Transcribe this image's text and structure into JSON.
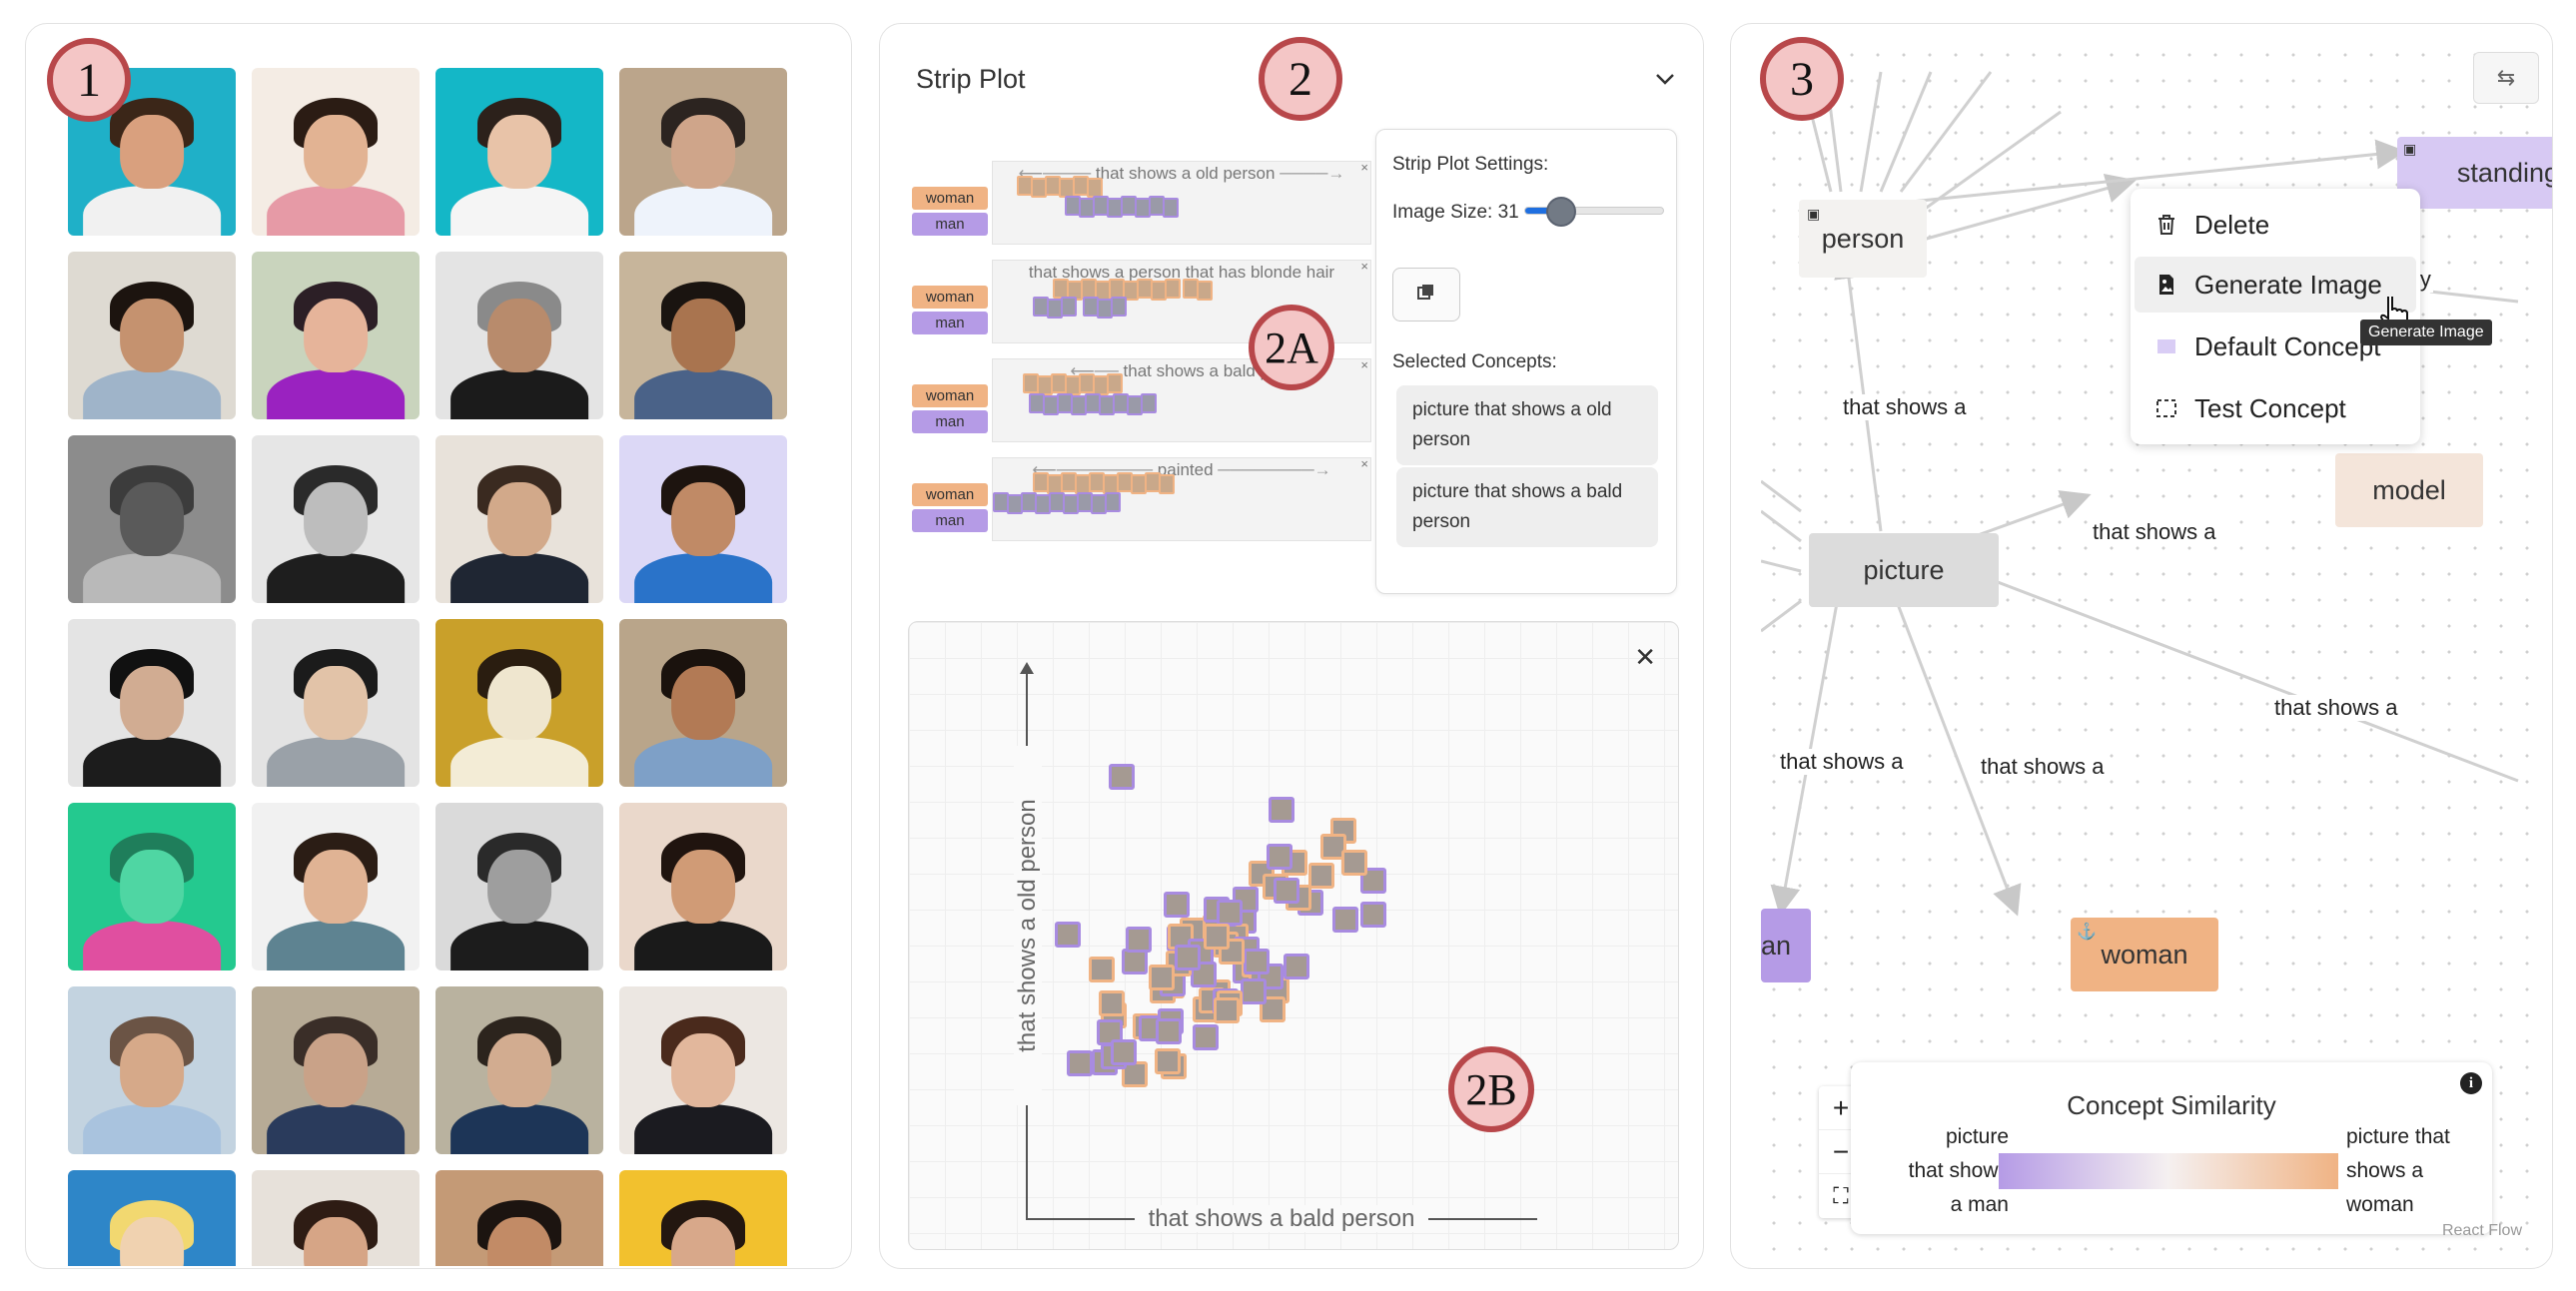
{
  "badges": {
    "b1": "1",
    "b2": "2",
    "b3": "3",
    "b2a": "2A",
    "b2b": "2B"
  },
  "gallery": {
    "thumbs": [
      {
        "bg": "#1fb0c8",
        "skin": "#d9a07e",
        "hair": "#3b2618",
        "body": "#f1f1f1"
      },
      {
        "bg": "#f4ece4",
        "skin": "#e2b393",
        "hair": "#2b1c14",
        "body": "#e69aa6"
      },
      {
        "bg": "#14b7c7",
        "skin": "#e8c3a8",
        "hair": "#2c211b",
        "body": "#f5f5f5"
      },
      {
        "bg": "#bba58b",
        "skin": "#cfa58a",
        "hair": "#2c2420",
        "body": "#eef3fb"
      },
      {
        "bg": "#dedad2",
        "skin": "#c5926f",
        "hair": "#1c140f",
        "body": "#9fb4c9"
      },
      {
        "bg": "#c9d4bd",
        "skin": "#e6b49a",
        "hair": "#2c1f26",
        "body": "#9a22c0"
      },
      {
        "bg": "#e4e4e4",
        "skin": "#b88b6c",
        "hair": "#8a8a8a",
        "body": "#1b1b1b"
      },
      {
        "bg": "#c7b59b",
        "skin": "#a9744f",
        "hair": "#1a1410",
        "body": "#4a6288"
      },
      {
        "bg": "#8c8c8c",
        "skin": "#5a5a5a",
        "hair": "#3c3c3c",
        "body": "#b9b9b9"
      },
      {
        "bg": "#e6e6e6",
        "skin": "#bdbdbd",
        "hair": "#2a2a2a",
        "body": "#1e1e1e"
      },
      {
        "bg": "#e8e2da",
        "skin": "#d2a98a",
        "hair": "#3a2a20",
        "body": "#1f2633"
      },
      {
        "bg": "#dcd8f6",
        "skin": "#c08a66",
        "hair": "#1d140f",
        "body": "#2a73c9"
      },
      {
        "bg": "#e4e4e4",
        "skin": "#d1ac92",
        "hair": "#111111",
        "body": "#1c1c1c"
      },
      {
        "bg": "#e3e3e3",
        "skin": "#e2c3a8",
        "hair": "#1b1b1b",
        "body": "#9aa1a8"
      },
      {
        "bg": "#c9a02a",
        "skin": "#efe6cf",
        "hair": "#2a1d10",
        "body": "#f3ecd6"
      },
      {
        "bg": "#b9a58a",
        "skin": "#b27a55",
        "hair": "#1a120d",
        "body": "#7ea0c7"
      },
      {
        "bg": "#24c98f",
        "skin": "#4fd6a3",
        "hair": "#1f7e5b",
        "body": "#e04fa0"
      },
      {
        "bg": "#f1f1f1",
        "skin": "#e0b394",
        "hair": "#2b1d15",
        "body": "#5e8391"
      },
      {
        "bg": "#dadada",
        "skin": "#9e9e9e",
        "hair": "#2a2a2a",
        "body": "#1c1c1c"
      },
      {
        "bg": "#ead8cb",
        "skin": "#d09b76",
        "hair": "#20140f",
        "body": "#1a1a1a"
      },
      {
        "bg": "#c3d3e0",
        "skin": "#d6a989",
        "hair": "#6b5445",
        "body": "#a9c3de"
      },
      {
        "bg": "#b7ab96",
        "skin": "#c9a288",
        "hair": "#3a2e28",
        "body": "#2a3b5c"
      },
      {
        "bg": "#b9b29f",
        "skin": "#d2ac90",
        "hair": "#2c241d",
        "body": "#1d3557"
      },
      {
        "bg": "#ece7e2",
        "skin": "#e2b79c",
        "hair": "#4a2a1c",
        "body": "#1b1b20"
      },
      {
        "bg": "#2e86c8",
        "skin": "#f0d2b0",
        "hair": "#f2d870",
        "body": "#cfe2f0"
      },
      {
        "bg": "#e7e1da",
        "skin": "#d6a586",
        "hair": "#2e1c14",
        "body": "#c5b7aa"
      },
      {
        "bg": "#c49a76",
        "skin": "#c28b66",
        "hair": "#1c1410",
        "body": "#a37050"
      },
      {
        "bg": "#f2c12e",
        "skin": "#d8a88a",
        "hair": "#231710",
        "body": "#1d2c6a"
      }
    ]
  },
  "strip": {
    "title": "Strip Plot",
    "rows": [
      {
        "caption": "that shows a old person",
        "woman": "woman",
        "man": "man",
        "arrows": true
      },
      {
        "caption": "that shows a person that has blonde hair",
        "woman": "woman",
        "man": "man",
        "arrows": false
      },
      {
        "caption": "that shows a bald pers",
        "woman": "woman",
        "man": "man",
        "arrows": true
      },
      {
        "caption": "painted",
        "woman": "woman",
        "man": "man",
        "arrows": true
      }
    ],
    "settings": {
      "heading": "Strip Plot Settings:",
      "size_label": "Image Size: 31",
      "size_value": 31,
      "size_fraction": 0.18,
      "selected_heading": "Selected Concepts:",
      "concepts": [
        "picture that shows a old person",
        "picture that shows a bald person"
      ]
    }
  },
  "scatter": {
    "xlabel": "that shows a bald person",
    "ylabel": "that shows a old person",
    "close": "✕"
  },
  "graph": {
    "nodes": {
      "person": "person",
      "standing": "standing",
      "model": "model",
      "picture": "picture",
      "woman": "woman",
      "man_partial": "an"
    },
    "edges": {
      "e1": "that shows a",
      "e2": "that shows a",
      "e3": "that shows a",
      "e4": "that shows a",
      "e5": "that shows a",
      "prop": "perty"
    },
    "menu": {
      "delete": "Delete",
      "generate": "Generate Image",
      "default": "Default Concept",
      "test": "Test Concept"
    },
    "tooltip": "Generate Image",
    "legend": {
      "title": "Concept Similarity",
      "left": "picture that shows a man",
      "left_lines": [
        "picture",
        "that shows",
        "a man"
      ],
      "right_lines": [
        "picture that",
        "shows a",
        "woman"
      ],
      "info": "i"
    },
    "zoom": {
      "plus": "+",
      "minus": "−",
      "fit": "⛶"
    },
    "attribution": "React Flow",
    "colors": {
      "woman": "#f0b384",
      "man": "#b59be6",
      "picture": "#dcdcdc",
      "person": "#f3f2f0"
    }
  }
}
